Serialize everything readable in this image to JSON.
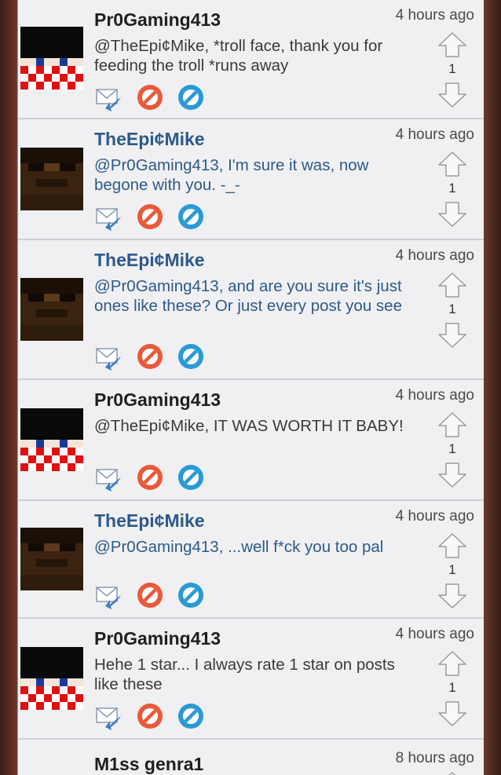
{
  "colors": {
    "text_dark": "#3a3a3a",
    "text_blue": "#2c5a8a",
    "reply_blue": "#3f7fc1",
    "block_red": "#e85a3a",
    "check_blue": "#2a9ad6",
    "divider": "#cfcfd3",
    "panel_bg": "#f0f0f2"
  },
  "icons": {
    "reply": "reply-mail-icon",
    "report": "no-entry-red-icon",
    "block": "no-entry-blue-icon",
    "up": "arrow-up-icon",
    "down": "arrow-down-icon"
  },
  "comments": [
    {
      "user": "Pr0Gaming413",
      "time": "4 hours ago",
      "text": "@TheEpi¢Mike, *troll face, thank you for feeding the troll *runs away",
      "score": "1",
      "avatar": "pr0gaming-avatar"
    },
    {
      "user": "TheEpi¢Mike",
      "time": "4 hours ago",
      "text": "@Pr0Gaming413, I'm sure it was, now begone with you. -_-",
      "score": "1",
      "avatar": "epicmike-avatar"
    },
    {
      "user": "TheEpi¢Mike",
      "time": "4 hours ago",
      "text": "@Pr0Gaming413, and are you sure it's just ones like these? Or just every post you see",
      "score": "1",
      "avatar": "epicmike-avatar"
    },
    {
      "user": "Pr0Gaming413",
      "time": "4 hours ago",
      "text": "@TheEpi¢Mike, IT WAS WORTH IT BABY!",
      "score": "1",
      "avatar": "pr0gaming-avatar"
    },
    {
      "user": "TheEpi¢Mike",
      "time": "4 hours ago",
      "text": "@Pr0Gaming413, ...well f*ck you too pal",
      "score": "1",
      "avatar": "epicmike-avatar"
    },
    {
      "user": "Pr0Gaming413",
      "time": "4 hours ago",
      "text": "Hehe 1 star... I always rate 1 star on posts like these",
      "score": "1",
      "avatar": "pr0gaming-avatar"
    },
    {
      "user": "M1ss genra1",
      "time": "8 hours ago",
      "text": "",
      "score": "",
      "avatar": ""
    }
  ]
}
